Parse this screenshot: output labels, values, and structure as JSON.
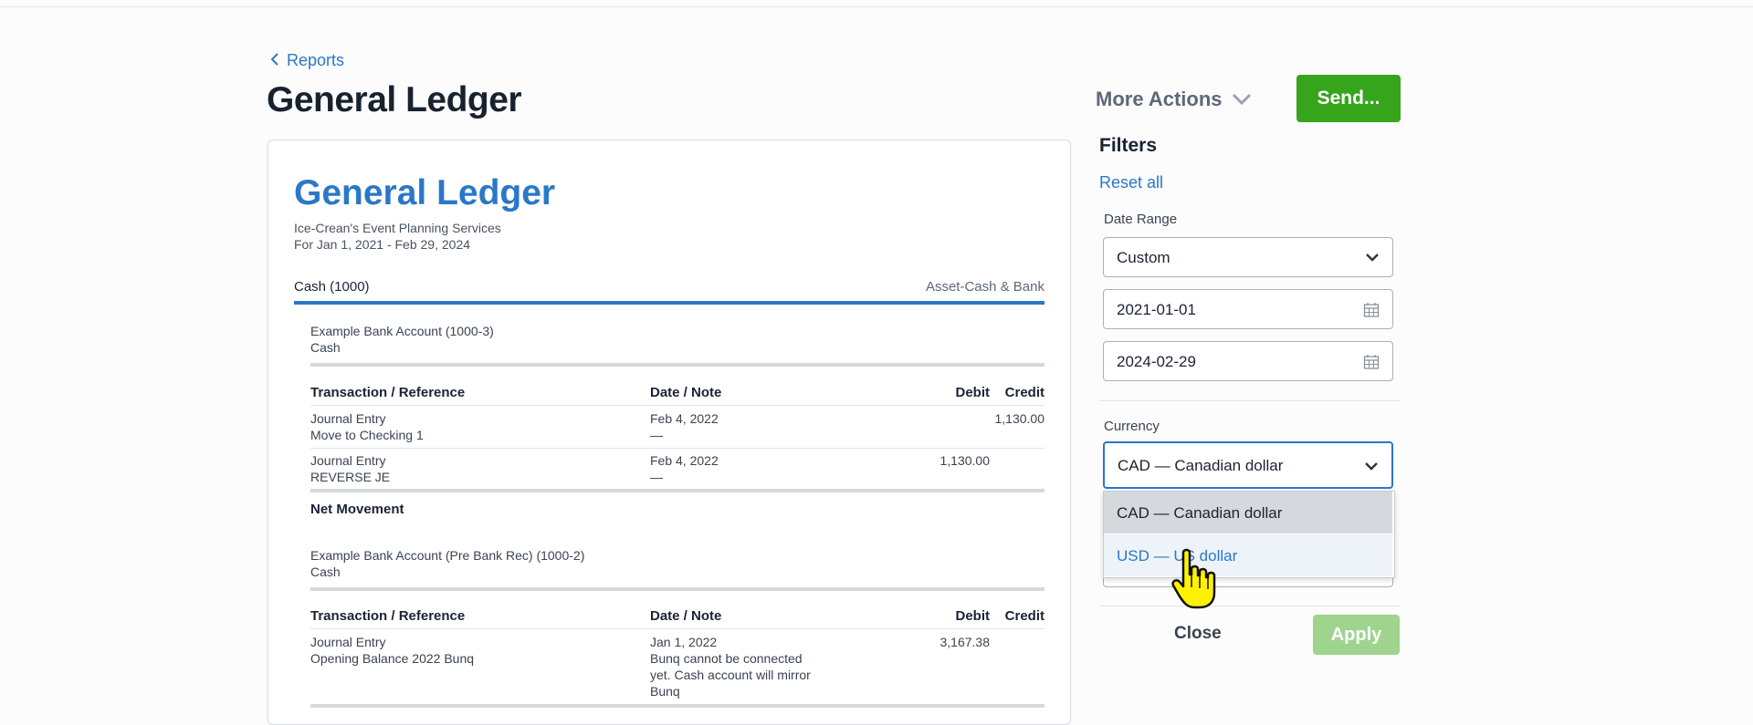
{
  "nav": {
    "back_label": "Reports"
  },
  "header": {
    "title": "General Ledger",
    "more_actions_label": "More Actions",
    "send_label": "Send..."
  },
  "report": {
    "title": "General Ledger",
    "company": "Ice-Crean's Event Planning Services",
    "period": "For Jan 1, 2021 - Feb 29, 2024",
    "account": {
      "name": "Cash (1000)",
      "type": "Asset-Cash & Bank"
    },
    "columns": {
      "transaction": "Transaction / Reference",
      "date": "Date / Note",
      "debit": "Debit",
      "credit": "Credit"
    },
    "sections": [
      {
        "name": "Example Bank Account (1000-3)",
        "type": "Cash",
        "rows": [
          {
            "transaction": "Journal Entry",
            "reference": "Move to Checking 1",
            "date": "Feb 4, 2022",
            "note": "—",
            "debit": "",
            "credit": "1,130.00"
          },
          {
            "transaction": "Journal Entry",
            "reference": "REVERSE JE",
            "date": "Feb 4, 2022",
            "note": "—",
            "debit": "1,130.00",
            "credit": ""
          }
        ],
        "net_label": "Net Movement"
      },
      {
        "name": "Example Bank Account (Pre Bank Rec) (1000-2)",
        "type": "Cash",
        "rows": [
          {
            "transaction": "Journal Entry",
            "reference": "Opening Balance 2022 Bunq",
            "date": "Jan 1, 2022",
            "note_lines": [
              "Bunq cannot be connected",
              "yet. Cash account will mirror",
              "Bunq"
            ],
            "debit": "3,167.38",
            "credit": ""
          }
        ]
      }
    ]
  },
  "filters": {
    "title": "Filters",
    "reset_label": "Reset all",
    "date_range_label": "Date Range",
    "date_range_value": "Custom",
    "start_date": "2021-01-01",
    "end_date": "2024-02-29",
    "currency_label": "Currency",
    "currency_value": "CAD — Canadian dollar",
    "currency_options": [
      "CAD — Canadian dollar",
      "USD — US dollar"
    ],
    "close_label": "Close",
    "apply_label": "Apply"
  },
  "colors": {
    "accent": "#2a78c8",
    "primary_button": "#37a51c",
    "apply_disabled": "#9fd48f"
  }
}
